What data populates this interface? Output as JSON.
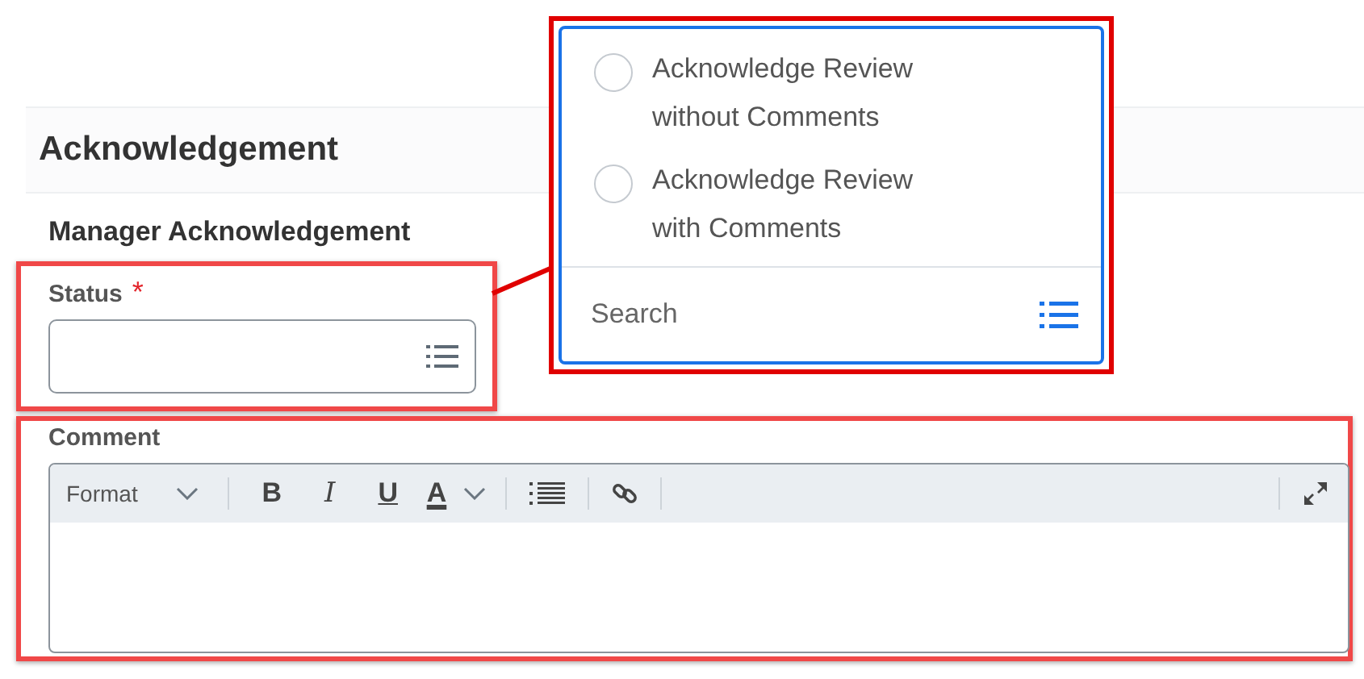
{
  "section": {
    "title": "Acknowledgement"
  },
  "subsection": {
    "title": "Manager Acknowledgement"
  },
  "status": {
    "label": "Status",
    "required": true,
    "required_mark": "*",
    "highlighted": true
  },
  "comment": {
    "label": "Comment",
    "highlighted": true,
    "toolbar": [
      {
        "kind": "select",
        "label": "Format"
      },
      {
        "kind": "divider"
      },
      {
        "kind": "bold",
        "label": "B"
      },
      {
        "kind": "italic",
        "label": "I"
      },
      {
        "kind": "underline",
        "label": "U"
      },
      {
        "kind": "color",
        "label": "A"
      },
      {
        "kind": "divider"
      },
      {
        "kind": "list"
      },
      {
        "kind": "divider"
      },
      {
        "kind": "link"
      },
      {
        "kind": "divider"
      }
    ]
  },
  "dropdown": {
    "highlighted": true,
    "options": [
      {
        "label": "Acknowledge Review without Comments",
        "selected": false
      },
      {
        "label": "Acknowledge Review with Comments",
        "selected": false
      }
    ],
    "search": {
      "placeholder": "Search"
    }
  }
}
